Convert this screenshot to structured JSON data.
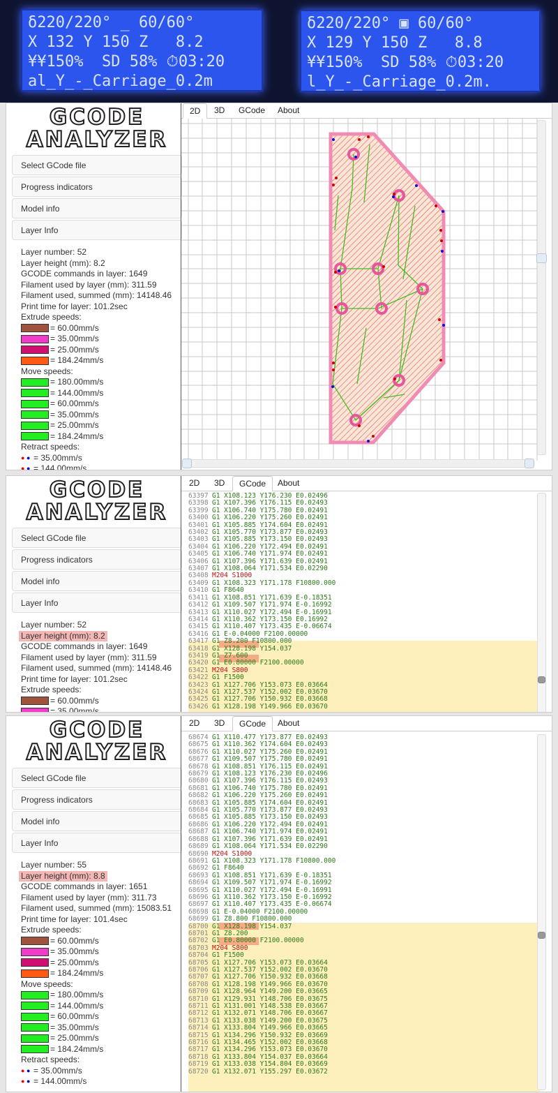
{
  "lcd_photos": [
    {
      "lines": [
        "δ220/220° _ 60/60°",
        "X 132 Y 150 Z   8.2",
        "¥¥150%  SD 58% ⏱03:20",
        "al_Y_-_Carriage_0.2m"
      ]
    },
    {
      "lines": [
        "δ220/220° ▣ 60/60°",
        "X 129 Y 150 Z   8.8",
        "¥¥150%  SD 58% ⏱03:20",
        "l_Y_-_Carriage_0.2m."
      ]
    }
  ],
  "logo": {
    "line1": "GCODE",
    "line2": "ANALYZER"
  },
  "accordion": {
    "select": "Select GCode file",
    "progress": "Progress indicators",
    "model": "Model info",
    "layer": "Layer Info"
  },
  "tabs": {
    "t2d": "2D",
    "t3d": "3D",
    "gcode": "GCode",
    "about": "About"
  },
  "panel1": {
    "layer_number": "Layer number: 52",
    "layer_height": "Layer height (mm): 8.2",
    "gcode_commands": "GCODE commands in layer: 1649",
    "filament_layer": "Filament used by layer (mm): 311.59",
    "filament_sum": "Filament used, summed (mm): 14148.46",
    "print_time": "Print time for layer: 101.2sec",
    "active_tab": "2D"
  },
  "panel2": {
    "layer_number": "Layer number: 52",
    "layer_height": "Layer height (mm): 8.2",
    "gcode_commands": "GCODE commands in layer: 1649",
    "filament_layer": "Filament used by layer (mm): 311.59",
    "filament_sum": "Filament used, summed (mm): 14148.46",
    "print_time": "Print time for layer: 101.2sec",
    "active_tab": "GCode"
  },
  "panel3": {
    "layer_number": "Layer number: 55",
    "layer_height": "Layer height (mm): 8.8",
    "gcode_commands": "GCODE commands in layer: 1651",
    "filament_layer": "Filament used by layer (mm): 311.73",
    "filament_sum": "Filament used, summed (mm): 15083.51",
    "print_time": "Print time for layer: 101.4sec",
    "active_tab": "GCode"
  },
  "legend": {
    "extrude_title": "Extrude speeds:",
    "extrude": [
      {
        "color": "#a0523c",
        "label": "= 60.00mm/s"
      },
      {
        "color": "#f03cc8",
        "label": "= 35.00mm/s"
      },
      {
        "color": "#d01070",
        "label": "= 25.00mm/s"
      },
      {
        "color": "#ff5a14",
        "label": "= 184.24mm/s"
      }
    ],
    "move_title": "Move speeds:",
    "move": [
      {
        "color": "#22ee22",
        "label": "= 180.00mm/s"
      },
      {
        "color": "#22ee22",
        "label": "= 144.00mm/s"
      },
      {
        "color": "#22ee22",
        "label": "= 60.00mm/s"
      },
      {
        "color": "#22ee22",
        "label": "= 35.00mm/s"
      },
      {
        "color": "#22ee22",
        "label": "= 25.00mm/s"
      },
      {
        "color": "#22ee22",
        "label": "= 184.24mm/s"
      }
    ],
    "retract_title": "Retract speeds:",
    "retract": [
      {
        "label": "= 35.00mm/s"
      },
      {
        "label": "= 144.00mm/s"
      }
    ]
  },
  "code1": [
    [
      "63397",
      "G1 X108.123 Y176.230 E0.02496"
    ],
    [
      "63398",
      "G1 X107.396 Y176.115 E0.02493"
    ],
    [
      "63399",
      "G1 X106.740 Y175.780 E0.02491"
    ],
    [
      "63400",
      "G1 X106.220 Y175.260 E0.02491"
    ],
    [
      "63401",
      "G1 X105.885 Y174.604 E0.02491"
    ],
    [
      "63402",
      "G1 X105.770 Y173.877 E0.02493"
    ],
    [
      "63403",
      "G1 X105.885 Y173.150 E0.02493"
    ],
    [
      "63404",
      "G1 X106.220 Y172.494 E0.02491"
    ],
    [
      "63405",
      "G1 X106.740 Y171.974 E0.02491"
    ],
    [
      "63406",
      "G1 X107.396 Y171.639 E0.02491"
    ],
    [
      "63407",
      "G1 X108.064 Y171.534 E0.02290"
    ],
    [
      "63408",
      "M204 S1000"
    ],
    [
      "63409",
      "G1 X108.323 Y171.178 F10800.000"
    ],
    [
      "63410",
      "G1 F8640"
    ],
    [
      "63411",
      "G1 X108.851 Y171.639 E-0.18351"
    ],
    [
      "63412",
      "G1 X109.507 Y171.974 E-0.16992"
    ],
    [
      "63413",
      "G1 X110.027 Y172.494 E-0.16991"
    ],
    [
      "63414",
      "G1 X110.362 Y173.150 E0.16992"
    ],
    [
      "63415",
      "G1 X110.407 Y173.435 E-0.06674"
    ],
    [
      "63416",
      "G1 E-0.04000 F2100.00000"
    ],
    [
      "63417",
      "G1 Z8.200 F10800.000"
    ],
    [
      "63418",
      "G1 X128.198 Y154.037"
    ],
    [
      "63419",
      "G1 Z7.600"
    ],
    [
      "63420",
      "G1 E0.80000 F2100.00000"
    ],
    [
      "63421",
      "M204 S800"
    ],
    [
      "63422",
      "G1 F1500"
    ],
    [
      "63423",
      "G1 X127.706 Y153.073 E0.03664"
    ],
    [
      "63424",
      "G1 X127.537 Y152.002 E0.03670"
    ],
    [
      "63425",
      "G1 X127.706 Y150.932 E0.03668"
    ],
    [
      "63426",
      "G1 X128.198 Y149.966 E0.03670"
    ]
  ],
  "code2": [
    [
      "68674",
      "G1 X110.477 Y173.877 E0.02493"
    ],
    [
      "68675",
      "G1 X110.362 Y174.604 E0.02493"
    ],
    [
      "68676",
      "G1 X110.027 Y175.260 E0.02491"
    ],
    [
      "68677",
      "G1 X109.507 Y175.780 E0.02491"
    ],
    [
      "68678",
      "G1 X108.851 Y176.115 E0.02491"
    ],
    [
      "68679",
      "G1 X108.123 Y176.230 E0.02496"
    ],
    [
      "68680",
      "G1 X107.396 Y176.115 E0.02493"
    ],
    [
      "68681",
      "G1 X106.740 Y175.780 E0.02491"
    ],
    [
      "68682",
      "G1 X106.220 Y175.260 E0.02491"
    ],
    [
      "68683",
      "G1 X105.885 Y174.604 E0.02491"
    ],
    [
      "68684",
      "G1 X105.770 Y173.877 E0.02493"
    ],
    [
      "68685",
      "G1 X105.885 Y173.150 E0.02493"
    ],
    [
      "68686",
      "G1 X106.220 Y172.494 E0.02491"
    ],
    [
      "68687",
      "G1 X106.740 Y171.974 E0.02491"
    ],
    [
      "68688",
      "G1 X107.396 Y171.639 E0.02491"
    ],
    [
      "68689",
      "G1 X108.064 Y171.534 E0.02290"
    ],
    [
      "68690",
      "M204 S1000"
    ],
    [
      "68691",
      "G1 X108.323 Y171.178 F10800.000"
    ],
    [
      "68692",
      "G1 F8640"
    ],
    [
      "68693",
      "G1 X108.851 Y171.639 E-0.18351"
    ],
    [
      "68694",
      "G1 X109.507 Y171.974 E-0.16992"
    ],
    [
      "68695",
      "G1 X110.027 Y172.494 E-0.16991"
    ],
    [
      "68696",
      "G1 X110.362 Y173.150 E-0.16992"
    ],
    [
      "68697",
      "G1 X110.407 Y173.435 E-0.06674"
    ],
    [
      "68698",
      "G1 E-0.04000 F2100.00000"
    ],
    [
      "68699",
      "G1 Z8.800 F10800.000"
    ],
    [
      "68700",
      "G1 X128.198 Y154.037"
    ],
    [
      "68701",
      "G1 Z8.200"
    ],
    [
      "68702",
      "G1 E0.80000 F2100.00000"
    ],
    [
      "68703",
      "M204 S800"
    ],
    [
      "68704",
      "G1 F1500"
    ],
    [
      "68705",
      "G1 X127.706 Y153.073 E0.03664"
    ],
    [
      "68706",
      "G1 X127.537 Y152.002 E0.03670"
    ],
    [
      "68707",
      "G1 X127.706 Y150.932 E0.03668"
    ],
    [
      "68708",
      "G1 X128.198 Y149.966 E0.03670"
    ],
    [
      "68709",
      "G1 X128.964 Y149.200 E0.03665"
    ],
    [
      "68710",
      "G1 X129.931 Y148.706 E0.03675"
    ],
    [
      "68711",
      "G1 X131.001 Y148.538 E0.03667"
    ],
    [
      "68712",
      "G1 X132.071 Y148.706 E0.03667"
    ],
    [
      "68713",
      "G1 X133.038 Y149.200 E0.03675"
    ],
    [
      "68714",
      "G1 X133.804 Y149.966 E0.03665"
    ],
    [
      "68715",
      "G1 X134.296 Y150.932 E0.03669"
    ],
    [
      "68716",
      "G1 X134.465 Y152.002 E0.03668"
    ],
    [
      "68717",
      "G1 X134.296 Y153.073 E0.03670"
    ],
    [
      "68718",
      "G1 X133.804 Y154.037 E0.03664"
    ],
    [
      "68719",
      "G1 X133.038 Y154.804 E0.03669"
    ],
    [
      "68720",
      "G1 X132.071 Y155.297 E0.03672"
    ]
  ]
}
